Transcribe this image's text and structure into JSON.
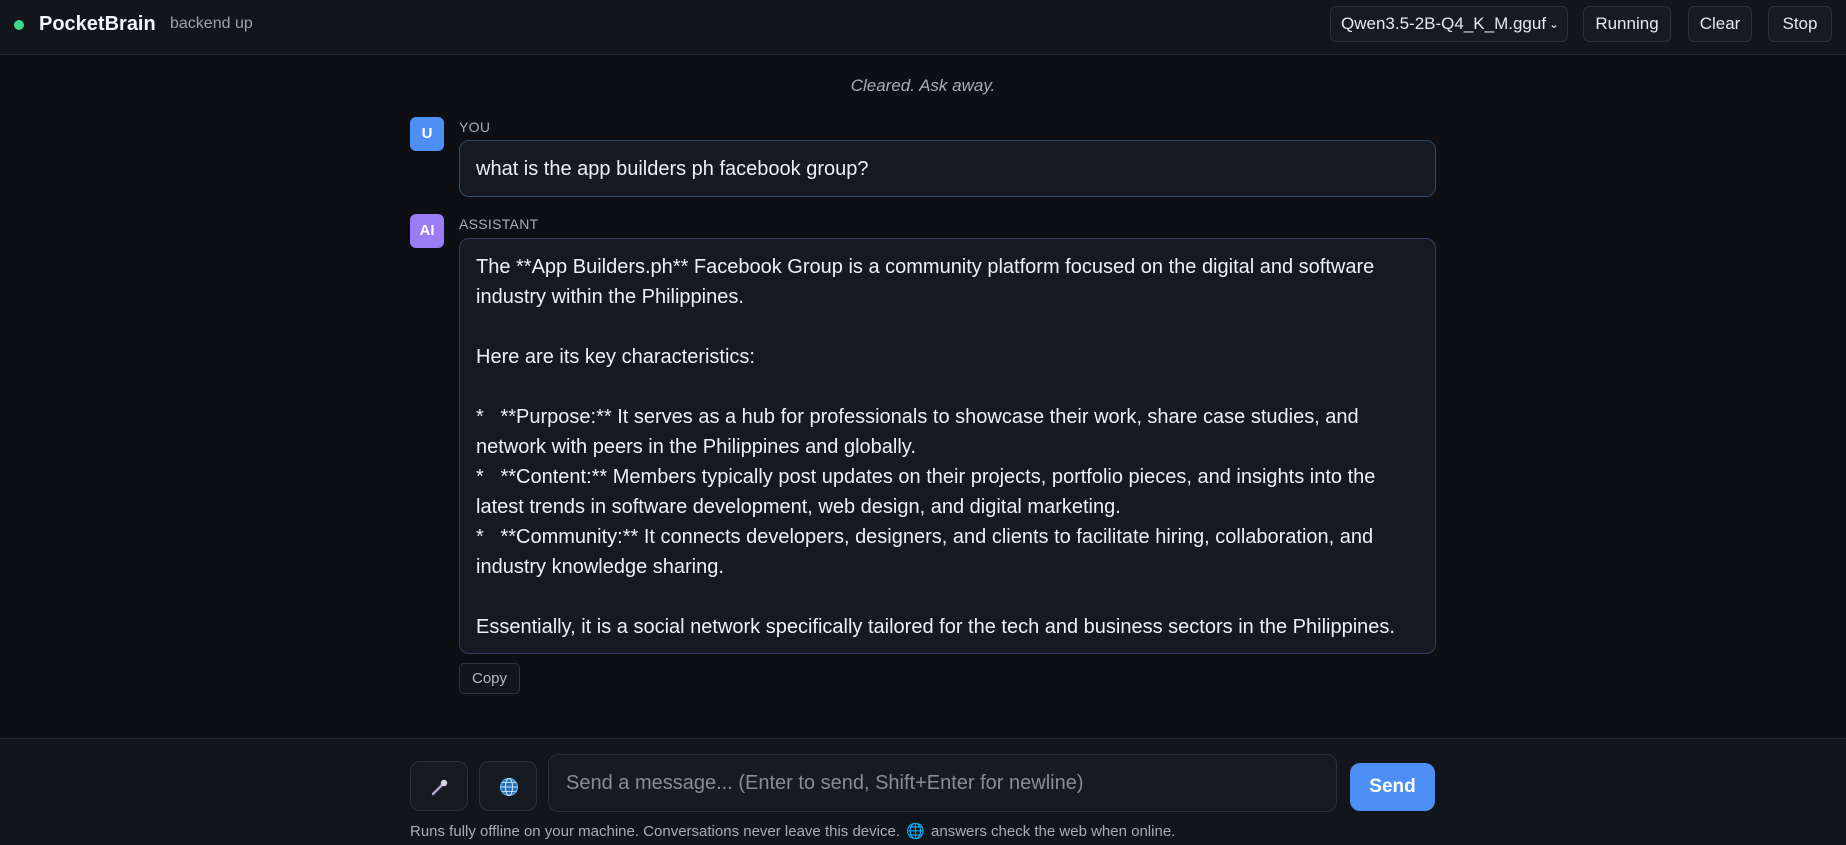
{
  "header": {
    "app_title": "PocketBrain",
    "backend_status": "backend up",
    "model_selected": "Qwen3.5-2B-Q4_K_M.gguf",
    "running_label": "Running",
    "clear_label": "Clear",
    "stop_label": "Stop",
    "status_color": "#3ddc84"
  },
  "chat": {
    "system_message": "Cleared. Ask away.",
    "user": {
      "avatar": "U",
      "role": "YOU",
      "message": "what is the app builders ph facebook group?"
    },
    "assistant": {
      "avatar": "AI",
      "role": "ASSISTANT",
      "message": "The **App Builders.ph** Facebook Group is a community platform focused on the digital and software industry within the Philippines.\n\nHere are its key characteristics:\n\n*   **Purpose:** It serves as a hub for professionals to showcase their work, share case studies, and network with peers in the Philippines and globally.\n*   **Content:** Members typically post updates on their projects, portfolio pieces, and insights into the latest trends in software development, web design, and digital marketing.\n*   **Community:** It connects developers, designers, and clients to facilitate hiring, collaboration, and industry knowledge sharing.\n\nEssentially, it is a social network specifically tailored for the tech and business sectors in the Philippines.",
      "copy_label": "Copy"
    }
  },
  "composer": {
    "mic_icon": "mic-icon",
    "web_icon": "globe-icon",
    "placeholder": "Send a message... (Enter to send, Shift+Enter for newline)",
    "send_label": "Send",
    "footer_before": "Runs fully offline on your machine. Conversations never leave this device.",
    "footer_globe": "🌐",
    "footer_after": "answers check the web when online."
  },
  "colors": {
    "accent": "#4d8ff5",
    "ai_avatar": "#9a7cf5",
    "background": "#0d0f14"
  }
}
